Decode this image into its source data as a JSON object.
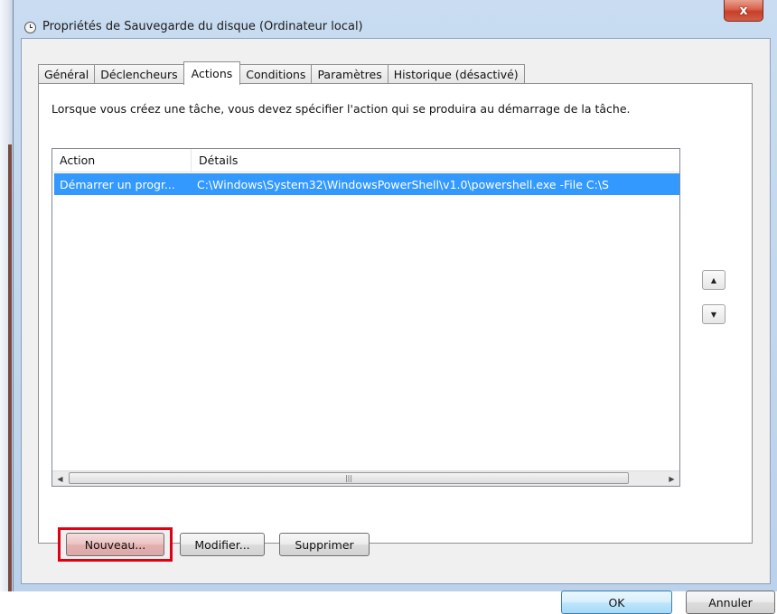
{
  "window": {
    "title": "Propriétés de Sauvegarde du disque (Ordinateur local)",
    "close_label": "x"
  },
  "tabs": [
    {
      "label": "Général",
      "active": false
    },
    {
      "label": "Déclencheurs",
      "active": false
    },
    {
      "label": "Actions",
      "active": true
    },
    {
      "label": "Conditions",
      "active": false
    },
    {
      "label": "Paramètres",
      "active": false
    },
    {
      "label": "Historique (désactivé)",
      "active": false
    }
  ],
  "actions_tab": {
    "description": "Lorsque vous créez une tâche, vous devez spécifier l'action qui se produira au démarrage de la tâche.",
    "columns": [
      "Action",
      "Détails"
    ],
    "rows": [
      {
        "action": "Démarrer un progr...",
        "details": "C:\\Windows\\System32\\WindowsPowerShell\\v1.0\\powershell.exe -File C:\\S",
        "selected": true
      }
    ],
    "buttons": {
      "new": "Nouveau...",
      "edit": "Modifier...",
      "delete": "Supprimer"
    }
  },
  "dialog_buttons": {
    "ok": "OK",
    "cancel": "Annuler"
  },
  "colors": {
    "selection": "#3399ff",
    "highlight_frame": "#e0000f",
    "window_frame": "#bcd1ea"
  }
}
